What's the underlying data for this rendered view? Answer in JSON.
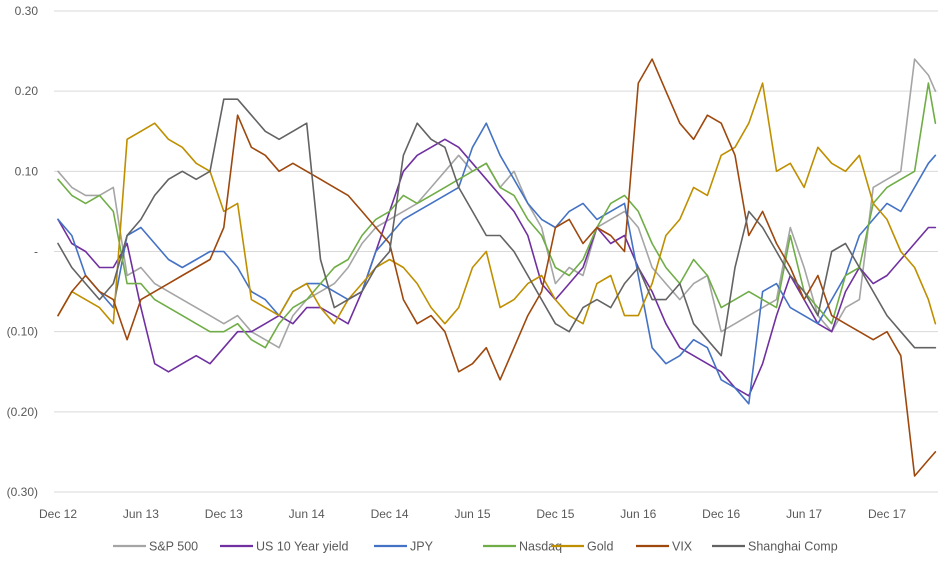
{
  "chart_data": {
    "type": "line",
    "title": "",
    "xlabel": "",
    "ylabel": "",
    "x_unit": "months since Dec 2012",
    "xlim": [
      0,
      63.5
    ],
    "ylim": [
      -0.3,
      0.3
    ],
    "y_ticks": [
      {
        "value": 0.3,
        "label": "0.30"
      },
      {
        "value": 0.2,
        "label": "0.20"
      },
      {
        "value": 0.1,
        "label": "0.10"
      },
      {
        "value": 0.0,
        "label": "-"
      },
      {
        "value": -0.1,
        "label": "(0.10)"
      },
      {
        "value": -0.2,
        "label": "(0.20)"
      },
      {
        "value": -0.3,
        "label": "(0.30)"
      }
    ],
    "x_ticks": [
      {
        "value": 0,
        "label": "Dec 12"
      },
      {
        "value": 6,
        "label": "Jun 13"
      },
      {
        "value": 12,
        "label": "Dec 13"
      },
      {
        "value": 18,
        "label": "Jun 14"
      },
      {
        "value": 24,
        "label": "Dec 14"
      },
      {
        "value": 30,
        "label": "Jun 15"
      },
      {
        "value": 36,
        "label": "Dec 15"
      },
      {
        "value": 42,
        "label": "Jun 16"
      },
      {
        "value": 48,
        "label": "Dec 16"
      },
      {
        "value": 54,
        "label": "Jun 17"
      },
      {
        "value": 60,
        "label": "Dec 17"
      }
    ],
    "grid": true,
    "legend": "bottom",
    "x": [
      0,
      1,
      2,
      3,
      4,
      5,
      6,
      7,
      8,
      9,
      10,
      11,
      12,
      13,
      14,
      15,
      16,
      17,
      18,
      19,
      20,
      21,
      22,
      23,
      24,
      25,
      26,
      27,
      28,
      29,
      30,
      31,
      32,
      33,
      34,
      35,
      36,
      37,
      38,
      39,
      40,
      41,
      42,
      43,
      44,
      45,
      46,
      47,
      48,
      49,
      50,
      51,
      52,
      53,
      54,
      55,
      56,
      57,
      58,
      59,
      60,
      61,
      62,
      63,
      63.5
    ],
    "series": [
      {
        "name": "S&P 500",
        "color": "#a5a5a5",
        "values": [
          0.1,
          0.08,
          0.07,
          0.07,
          0.08,
          -0.03,
          -0.02,
          -0.04,
          -0.05,
          -0.06,
          -0.07,
          -0.08,
          -0.09,
          -0.08,
          -0.1,
          -0.11,
          -0.12,
          -0.08,
          -0.06,
          -0.05,
          -0.04,
          -0.02,
          0.01,
          0.03,
          0.04,
          0.05,
          0.06,
          0.08,
          0.1,
          0.12,
          0.1,
          0.11,
          0.08,
          0.1,
          0.06,
          0.03,
          -0.04,
          -0.02,
          -0.03,
          0.03,
          0.04,
          0.05,
          0.03,
          -0.02,
          -0.04,
          -0.06,
          -0.04,
          -0.03,
          -0.1,
          -0.09,
          -0.08,
          -0.07,
          -0.06,
          0.03,
          -0.02,
          -0.08,
          -0.1,
          -0.07,
          -0.06,
          0.08,
          0.09,
          0.1,
          0.24,
          0.22,
          0.2
        ]
      },
      {
        "name": "US 10 Year yield",
        "color": "#7030a0",
        "values": [
          0.04,
          0.01,
          0.0,
          -0.02,
          -0.02,
          0.01,
          -0.07,
          -0.14,
          -0.15,
          -0.14,
          -0.13,
          -0.14,
          -0.12,
          -0.1,
          -0.1,
          -0.09,
          -0.08,
          -0.09,
          -0.07,
          -0.07,
          -0.08,
          -0.09,
          -0.05,
          0.0,
          0.05,
          0.1,
          0.12,
          0.13,
          0.14,
          0.13,
          0.11,
          0.09,
          0.07,
          0.05,
          0.02,
          -0.04,
          -0.06,
          -0.04,
          -0.02,
          0.03,
          0.01,
          0.02,
          -0.02,
          -0.05,
          -0.09,
          -0.12,
          -0.13,
          -0.14,
          -0.15,
          -0.17,
          -0.18,
          -0.14,
          -0.08,
          -0.03,
          -0.06,
          -0.09,
          -0.1,
          -0.05,
          -0.02,
          -0.04,
          -0.03,
          -0.01,
          0.01,
          0.03,
          0.03
        ]
      },
      {
        "name": "JPY",
        "color": "#4472c4",
        "values": [
          0.04,
          0.02,
          -0.03,
          -0.05,
          -0.07,
          0.02,
          0.03,
          0.01,
          -0.01,
          -0.02,
          -0.01,
          0.0,
          0.0,
          -0.02,
          -0.05,
          -0.06,
          -0.08,
          -0.05,
          -0.04,
          -0.04,
          -0.05,
          -0.06,
          -0.05,
          0.0,
          0.02,
          0.04,
          0.05,
          0.06,
          0.07,
          0.08,
          0.13,
          0.16,
          0.12,
          0.09,
          0.06,
          0.04,
          0.03,
          0.05,
          0.06,
          0.04,
          0.05,
          0.06,
          -0.03,
          -0.12,
          -0.14,
          -0.13,
          -0.11,
          -0.12,
          -0.16,
          -0.17,
          -0.19,
          -0.05,
          -0.04,
          -0.07,
          -0.08,
          -0.09,
          -0.06,
          -0.03,
          0.02,
          0.04,
          0.06,
          0.05,
          0.08,
          0.11,
          0.12
        ]
      },
      {
        "name": "Nasdaq",
        "color": "#70ad47",
        "values": [
          0.09,
          0.07,
          0.06,
          0.07,
          0.05,
          -0.04,
          -0.04,
          -0.06,
          -0.07,
          -0.08,
          -0.09,
          -0.1,
          -0.1,
          -0.09,
          -0.11,
          -0.12,
          -0.09,
          -0.07,
          -0.06,
          -0.04,
          -0.02,
          -0.01,
          0.02,
          0.04,
          0.05,
          0.07,
          0.06,
          0.07,
          0.08,
          0.09,
          0.1,
          0.11,
          0.08,
          0.07,
          0.04,
          0.02,
          -0.02,
          -0.03,
          -0.01,
          0.03,
          0.06,
          0.07,
          0.05,
          0.01,
          -0.02,
          -0.04,
          -0.01,
          -0.03,
          -0.07,
          -0.06,
          -0.05,
          -0.06,
          -0.07,
          0.02,
          -0.05,
          -0.07,
          -0.09,
          -0.03,
          -0.02,
          0.06,
          0.08,
          0.09,
          0.1,
          0.21,
          0.16
        ]
      },
      {
        "name": "Gold",
        "color": "#bf8f00",
        "values": [
          -0.08,
          -0.05,
          -0.06,
          -0.07,
          -0.09,
          0.14,
          0.15,
          0.16,
          0.14,
          0.13,
          0.11,
          0.1,
          0.05,
          0.06,
          -0.06,
          -0.07,
          -0.08,
          -0.05,
          -0.04,
          -0.07,
          -0.09,
          -0.06,
          -0.04,
          -0.02,
          -0.01,
          -0.02,
          -0.04,
          -0.07,
          -0.09,
          -0.07,
          -0.02,
          0.0,
          -0.07,
          -0.06,
          -0.04,
          -0.03,
          -0.06,
          -0.08,
          -0.09,
          -0.04,
          -0.03,
          -0.08,
          -0.08,
          -0.04,
          0.02,
          0.04,
          0.08,
          0.07,
          0.12,
          0.13,
          0.16,
          0.21,
          0.1,
          0.11,
          0.08,
          0.13,
          0.11,
          0.1,
          0.12,
          0.06,
          0.04,
          0.0,
          -0.02,
          -0.06,
          -0.09
        ]
      },
      {
        "name": "VIX",
        "color": "#9e480e",
        "values": [
          -0.08,
          -0.05,
          -0.03,
          -0.05,
          -0.06,
          -0.11,
          -0.06,
          -0.05,
          -0.04,
          -0.03,
          -0.02,
          -0.01,
          0.03,
          0.17,
          0.13,
          0.12,
          0.1,
          0.11,
          0.1,
          0.09,
          0.08,
          0.07,
          0.05,
          0.03,
          0.01,
          -0.06,
          -0.09,
          -0.08,
          -0.1,
          -0.15,
          -0.14,
          -0.12,
          -0.16,
          -0.12,
          -0.08,
          -0.05,
          0.03,
          0.04,
          0.01,
          0.03,
          0.02,
          0.0,
          0.21,
          0.24,
          0.2,
          0.16,
          0.14,
          0.17,
          0.16,
          0.12,
          0.02,
          0.05,
          0.01,
          -0.02,
          -0.06,
          -0.03,
          -0.08,
          -0.09,
          -0.1,
          -0.11,
          -0.1,
          -0.13,
          -0.28,
          -0.26,
          -0.25
        ]
      },
      {
        "name": "Shanghai Comp",
        "color": "#636363",
        "values": [
          0.01,
          -0.02,
          -0.04,
          -0.06,
          -0.04,
          0.02,
          0.04,
          0.07,
          0.09,
          0.1,
          0.09,
          0.1,
          0.19,
          0.19,
          0.17,
          0.15,
          0.14,
          0.15,
          0.16,
          -0.01,
          -0.07,
          -0.06,
          -0.05,
          -0.02,
          0.0,
          0.12,
          0.16,
          0.14,
          0.13,
          0.08,
          0.05,
          0.02,
          0.02,
          0.0,
          -0.03,
          -0.06,
          -0.09,
          -0.1,
          -0.07,
          -0.06,
          -0.07,
          -0.04,
          -0.02,
          -0.06,
          -0.06,
          -0.04,
          -0.09,
          -0.11,
          -0.13,
          -0.02,
          0.05,
          0.03,
          0.0,
          -0.03,
          -0.05,
          -0.08,
          0.0,
          0.01,
          -0.02,
          -0.05,
          -0.08,
          -0.1,
          -0.12,
          -0.12,
          -0.12
        ]
      }
    ]
  }
}
